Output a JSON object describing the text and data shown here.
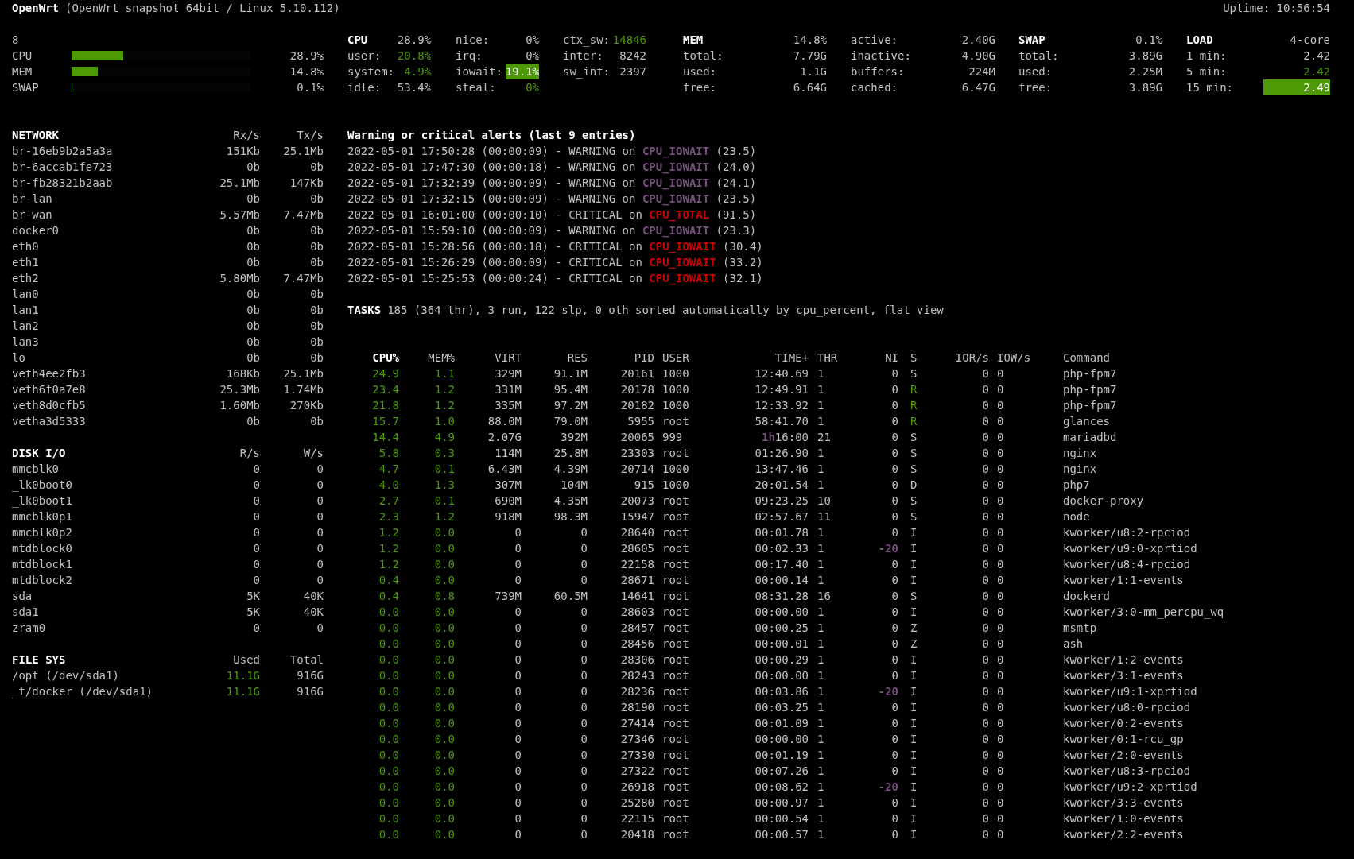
{
  "header": {
    "hostname": "OpenWrt",
    "system": "(OpenWrt snapshot 64bit / Linux 5.10.112)",
    "uptime": "Uptime: 10:56:54"
  },
  "quicklook": {
    "label": "8",
    "bars": [
      {
        "label": "CPU",
        "level": 0.289,
        "value": "28.9%"
      },
      {
        "label": "MEM",
        "level": 0.148,
        "value": "14.8%"
      },
      {
        "label": "SWAP",
        "level": 0.001,
        "value": "0.1%"
      }
    ]
  },
  "cpu": {
    "title": "CPU",
    "value": "28.9%",
    "stats": [
      {
        "label": "user:",
        "value": "20.8%",
        "good": true,
        "highlighted": false
      },
      {
        "label": "system:",
        "value": "4.9%",
        "good": true,
        "highlighted": false
      },
      {
        "label": "idle:",
        "value": "53.4%",
        "good": false,
        "highlighted": false
      }
    ],
    "extra_columns": [
      [
        {
          "label": "nice:",
          "value": "0%",
          "good": false,
          "highlighted": false
        },
        {
          "label": "irq:",
          "value": "0%",
          "good": false,
          "highlighted": false
        },
        {
          "label": "iowait:",
          "value": "19.1%",
          "good": true,
          "highlighted": true
        },
        {
          "label": "steal:",
          "value": "0%",
          "good": true,
          "highlighted": false
        }
      ],
      [
        {
          "label": "ctx_sw:",
          "value": "14846",
          "good": true,
          "highlighted": false
        },
        {
          "label": "inter:",
          "value": "8242",
          "good": false,
          "highlighted": false
        },
        {
          "label": "sw_int:",
          "value": "2397",
          "good": false,
          "highlighted": false
        }
      ]
    ]
  },
  "mem": {
    "title": "MEM",
    "value": "14.8%",
    "stats": [
      {
        "label": "total:",
        "value": "7.79G",
        "good": false,
        "highlighted": false
      },
      {
        "label": "used:",
        "value": "1.1G",
        "good": false,
        "highlighted": false
      },
      {
        "label": "free:",
        "value": "6.64G",
        "good": false,
        "highlighted": false
      }
    ],
    "extra_columns": [
      [
        {
          "label": "active:",
          "value": "2.40G",
          "good": false,
          "highlighted": false
        },
        {
          "label": "inactive:",
          "value": "4.90G",
          "good": false,
          "highlighted": false
        },
        {
          "label": "buffers:",
          "value": "224M",
          "good": false,
          "highlighted": false
        },
        {
          "label": "cached:",
          "value": "6.47G",
          "good": false,
          "highlighted": false
        }
      ]
    ]
  },
  "swap": {
    "title": "SWAP",
    "value": "0.1%",
    "stats": [
      {
        "label": "total:",
        "value": "3.89G",
        "good": false,
        "highlighted": false
      },
      {
        "label": "used:",
        "value": "2.25M",
        "good": false,
        "highlighted": false
      },
      {
        "label": "free:",
        "value": "3.89G",
        "good": false,
        "highlighted": false
      }
    ]
  },
  "load": {
    "title": "LOAD",
    "value": "4-core",
    "stats": [
      {
        "label": "1 min:",
        "value": "2.42",
        "good": false,
        "highlighted": false
      },
      {
        "label": "5 min:",
        "value": "2.42",
        "good": true,
        "highlighted": false
      },
      {
        "label": "15 min:",
        "value": "2.49",
        "good": true,
        "highlighted": true
      }
    ]
  },
  "network": {
    "title": "NETWORK",
    "columns": [
      "Rx/s",
      "Tx/s"
    ],
    "rows": [
      {
        "name": "br-16eb9b2a5a3a",
        "rx": "151Kb",
        "tx": "25.1Mb"
      },
      {
        "name": "br-6accab1fe723",
        "rx": "0b",
        "tx": "0b"
      },
      {
        "name": "br-fb28321b2aab",
        "rx": "25.1Mb",
        "tx": "147Kb"
      },
      {
        "name": "br-lan",
        "rx": "0b",
        "tx": "0b"
      },
      {
        "name": "br-wan",
        "rx": "5.57Mb",
        "tx": "7.47Mb"
      },
      {
        "name": "docker0",
        "rx": "0b",
        "tx": "0b"
      },
      {
        "name": "eth0",
        "rx": "0b",
        "tx": "0b"
      },
      {
        "name": "eth1",
        "rx": "0b",
        "tx": "0b"
      },
      {
        "name": "eth2",
        "rx": "5.80Mb",
        "tx": "7.47Mb"
      },
      {
        "name": "lan0",
        "rx": "0b",
        "tx": "0b"
      },
      {
        "name": "lan1",
        "rx": "0b",
        "tx": "0b"
      },
      {
        "name": "lan2",
        "rx": "0b",
        "tx": "0b"
      },
      {
        "name": "lan3",
        "rx": "0b",
        "tx": "0b"
      },
      {
        "name": "lo",
        "rx": "0b",
        "tx": "0b"
      },
      {
        "name": "veth4ee2fb3",
        "rx": "168Kb",
        "tx": "25.1Mb"
      },
      {
        "name": "veth6f0a7e8",
        "rx": "25.3Mb",
        "tx": "1.74Mb"
      },
      {
        "name": "veth8d0cfb5",
        "rx": "1.60Mb",
        "tx": "270Kb"
      },
      {
        "name": "vetha3d5333",
        "rx": "0b",
        "tx": "0b"
      }
    ]
  },
  "disk_io": {
    "title": "DISK I/O",
    "columns": [
      "R/s",
      "W/s"
    ],
    "rows": [
      {
        "name": "mmcblk0",
        "rx": "0",
        "tx": "0"
      },
      {
        "name": "_lk0boot0",
        "rx": "0",
        "tx": "0"
      },
      {
        "name": "_lk0boot1",
        "rx": "0",
        "tx": "0"
      },
      {
        "name": "mmcblk0p1",
        "rx": "0",
        "tx": "0"
      },
      {
        "name": "mmcblk0p2",
        "rx": "0",
        "tx": "0"
      },
      {
        "name": "mtdblock0",
        "rx": "0",
        "tx": "0"
      },
      {
        "name": "mtdblock1",
        "rx": "0",
        "tx": "0"
      },
      {
        "name": "mtdblock2",
        "rx": "0",
        "tx": "0"
      },
      {
        "name": "sda",
        "rx": "5K",
        "tx": "40K"
      },
      {
        "name": "sda1",
        "rx": "5K",
        "tx": "40K"
      },
      {
        "name": "zram0",
        "rx": "0",
        "tx": "0"
      }
    ]
  },
  "file_sys": {
    "title": "FILE SYS",
    "columns": [
      "Used",
      "Total"
    ],
    "rows": [
      {
        "name": "/opt (/dev/sda1)",
        "rx": "11.1G",
        "tx": "916G"
      },
      {
        "name": "_t/docker (/dev/sda1)",
        "rx": "11.1G",
        "tx": "916G"
      }
    ]
  },
  "alerts": {
    "title": "Warning or critical alerts (last 9 entries)",
    "entries": [
      {
        "text": "2022-05-01 17:50:28 (00:00:09) - WARNING on",
        "metric": "CPU_IOWAIT",
        "value": "(23.5)",
        "critical": false
      },
      {
        "text": "2022-05-01 17:47:30 (00:00:18) - WARNING on",
        "metric": "CPU_IOWAIT",
        "value": "(24.0)",
        "critical": false
      },
      {
        "text": "2022-05-01 17:32:39 (00:00:09) - WARNING on",
        "metric": "CPU_IOWAIT",
        "value": "(24.1)",
        "critical": false
      },
      {
        "text": "2022-05-01 17:32:15 (00:00:09) - WARNING on",
        "metric": "CPU_IOWAIT",
        "value": "(23.5)",
        "critical": false
      },
      {
        "text": "2022-05-01 16:01:00 (00:00:10) - CRITICAL on",
        "metric": "CPU_TOTAL",
        "value": "(91.5)",
        "critical": true
      },
      {
        "text": "2022-05-01 15:59:10 (00:00:09) - WARNING on",
        "metric": "CPU_IOWAIT",
        "value": "(23.3)",
        "critical": false
      },
      {
        "text": "2022-05-01 15:28:56 (00:00:18) - CRITICAL on",
        "metric": "CPU_IOWAIT",
        "value": "(30.4)",
        "critical": true
      },
      {
        "text": "2022-05-01 15:26:29 (00:00:09) - CRITICAL on",
        "metric": "CPU_IOWAIT",
        "value": "(33.2)",
        "critical": true
      },
      {
        "text": "2022-05-01 15:25:53 (00:00:24) - CRITICAL on",
        "metric": "CPU_IOWAIT",
        "value": "(32.1)",
        "critical": true
      }
    ]
  },
  "tasks": {
    "title": "TASKS",
    "summary": "185 (364 thr), 3 run, 122 slp, 0 oth sorted automatically by cpu_percent, flat view"
  },
  "processes": {
    "columns": [
      {
        "label": "CPU%",
        "selected": true
      },
      {
        "label": "MEM%",
        "selected": false
      },
      {
        "label": "VIRT",
        "selected": false
      },
      {
        "label": "RES",
        "selected": false
      },
      {
        "label": "PID",
        "selected": false
      },
      {
        "label": "USER",
        "selected": false
      },
      {
        "label": "TIME+",
        "selected": false
      },
      {
        "label": "THR",
        "selected": false
      },
      {
        "label": "NI",
        "selected": false
      },
      {
        "label": "S",
        "selected": false
      },
      {
        "label": "IOR/s",
        "selected": false
      },
      {
        "label": "IOW/s",
        "selected": false
      },
      {
        "label": "Command",
        "selected": false
      }
    ],
    "rows": [
      {
        "cpu": "24.9",
        "mem": "1.1",
        "virt": "329M",
        "res": "91.1M",
        "pid": "20161",
        "user": "1000",
        "time": "12:40.69",
        "thr": "1",
        "ni": "0",
        "ni_alert": false,
        "s": "S",
        "s_running": false,
        "ior": "0",
        "iow": "0",
        "command": "php-fpm7"
      },
      {
        "cpu": "23.4",
        "mem": "1.2",
        "virt": "331M",
        "res": "95.4M",
        "pid": "20178",
        "user": "1000",
        "time": "12:49.91",
        "thr": "1",
        "ni": "0",
        "ni_alert": false,
        "s": "R",
        "s_running": true,
        "ior": "0",
        "iow": "0",
        "command": "php-fpm7"
      },
      {
        "cpu": "21.8",
        "mem": "1.2",
        "virt": "335M",
        "res": "97.2M",
        "pid": "20182",
        "user": "1000",
        "time": "12:33.92",
        "thr": "1",
        "ni": "0",
        "ni_alert": false,
        "s": "R",
        "s_running": true,
        "ior": "0",
        "iow": "0",
        "command": "php-fpm7"
      },
      {
        "cpu": "15.7",
        "mem": "1.0",
        "virt": "88.0M",
        "res": "79.0M",
        "pid": "5955",
        "user": "root",
        "time": "58:41.70",
        "thr": "1",
        "ni": "0",
        "ni_alert": false,
        "s": "R",
        "s_running": true,
        "ior": "0",
        "iow": "0",
        "command": "glances"
      },
      {
        "cpu": "14.4",
        "mem": "4.9",
        "virt": "2.07G",
        "res": "392M",
        "pid": "20065",
        "user": "999",
        "time_prefix": "1h",
        "time": "16:00",
        "thr": "21",
        "ni": "0",
        "ni_alert": false,
        "s": "S",
        "s_running": false,
        "ior": "0",
        "iow": "0",
        "command": "mariadbd"
      },
      {
        "cpu": "5.8",
        "mem": "0.3",
        "virt": "114M",
        "res": "25.8M",
        "pid": "23303",
        "user": "root",
        "time": "01:26.90",
        "thr": "1",
        "ni": "0",
        "ni_alert": false,
        "s": "S",
        "s_running": false,
        "ior": "0",
        "iow": "0",
        "command": "nginx"
      },
      {
        "cpu": "4.7",
        "mem": "0.1",
        "virt": "6.43M",
        "res": "4.39M",
        "pid": "20714",
        "user": "1000",
        "time": "13:47.46",
        "thr": "1",
        "ni": "0",
        "ni_alert": false,
        "s": "S",
        "s_running": false,
        "ior": "0",
        "iow": "0",
        "command": "nginx"
      },
      {
        "cpu": "4.0",
        "mem": "1.3",
        "virt": "307M",
        "res": "104M",
        "pid": "915",
        "user": "1000",
        "time": "20:01.54",
        "thr": "1",
        "ni": "0",
        "ni_alert": false,
        "s": "D",
        "s_running": false,
        "ior": "0",
        "iow": "0",
        "command": "php7"
      },
      {
        "cpu": "2.7",
        "mem": "0.1",
        "virt": "690M",
        "res": "4.35M",
        "pid": "20073",
        "user": "root",
        "time": "09:23.25",
        "thr": "10",
        "ni": "0",
        "ni_alert": false,
        "s": "S",
        "s_running": false,
        "ior": "0",
        "iow": "0",
        "command": "docker-proxy"
      },
      {
        "cpu": "2.3",
        "mem": "1.2",
        "virt": "918M",
        "res": "98.3M",
        "pid": "15947",
        "user": "root",
        "time": "02:57.67",
        "thr": "11",
        "ni": "0",
        "ni_alert": false,
        "s": "S",
        "s_running": false,
        "ior": "0",
        "iow": "0",
        "command": "node"
      },
      {
        "cpu": "1.2",
        "mem": "0.0",
        "virt": "0",
        "res": "0",
        "pid": "28640",
        "user": "root",
        "time": "00:01.78",
        "thr": "1",
        "ni": "0",
        "ni_alert": false,
        "s": "I",
        "s_running": false,
        "ior": "0",
        "iow": "0",
        "command": "kworker/u8:2-rpciod"
      },
      {
        "cpu": "1.2",
        "mem": "0.0",
        "virt": "0",
        "res": "0",
        "pid": "28605",
        "user": "root",
        "time": "00:02.33",
        "thr": "1",
        "ni": "-20",
        "ni_alert": true,
        "s": "I",
        "s_running": false,
        "ior": "0",
        "iow": "0",
        "command": "kworker/u9:0-xprtiod"
      },
      {
        "cpu": "1.2",
        "mem": "0.0",
        "virt": "0",
        "res": "0",
        "pid": "22158",
        "user": "root",
        "time": "00:17.40",
        "thr": "1",
        "ni": "0",
        "ni_alert": false,
        "s": "I",
        "s_running": false,
        "ior": "0",
        "iow": "0",
        "command": "kworker/u8:4-rpciod"
      },
      {
        "cpu": "0.4",
        "mem": "0.0",
        "virt": "0",
        "res": "0",
        "pid": "28671",
        "user": "root",
        "time": "00:00.14",
        "thr": "1",
        "ni": "0",
        "ni_alert": false,
        "s": "I",
        "s_running": false,
        "ior": "0",
        "iow": "0",
        "command": "kworker/1:1-events"
      },
      {
        "cpu": "0.4",
        "mem": "0.8",
        "virt": "739M",
        "res": "60.5M",
        "pid": "14641",
        "user": "root",
        "time": "08:31.28",
        "thr": "16",
        "ni": "0",
        "ni_alert": false,
        "s": "S",
        "s_running": false,
        "ior": "0",
        "iow": "0",
        "command": "dockerd"
      },
      {
        "cpu": "0.0",
        "mem": "0.0",
        "virt": "0",
        "res": "0",
        "pid": "28603",
        "user": "root",
        "time": "00:00.00",
        "thr": "1",
        "ni": "0",
        "ni_alert": false,
        "s": "I",
        "s_running": false,
        "ior": "0",
        "iow": "0",
        "command": "kworker/3:0-mm_percpu_wq"
      },
      {
        "cpu": "0.0",
        "mem": "0.0",
        "virt": "0",
        "res": "0",
        "pid": "28457",
        "user": "root",
        "time": "00:00.25",
        "thr": "1",
        "ni": "0",
        "ni_alert": false,
        "s": "Z",
        "s_running": false,
        "ior": "0",
        "iow": "0",
        "command": "msmtp"
      },
      {
        "cpu": "0.0",
        "mem": "0.0",
        "virt": "0",
        "res": "0",
        "pid": "28456",
        "user": "root",
        "time": "00:00.01",
        "thr": "1",
        "ni": "0",
        "ni_alert": false,
        "s": "Z",
        "s_running": false,
        "ior": "0",
        "iow": "0",
        "command": "ash"
      },
      {
        "cpu": "0.0",
        "mem": "0.0",
        "virt": "0",
        "res": "0",
        "pid": "28306",
        "user": "root",
        "time": "00:00.29",
        "thr": "1",
        "ni": "0",
        "ni_alert": false,
        "s": "I",
        "s_running": false,
        "ior": "0",
        "iow": "0",
        "command": "kworker/1:2-events"
      },
      {
        "cpu": "0.0",
        "mem": "0.0",
        "virt": "0",
        "res": "0",
        "pid": "28243",
        "user": "root",
        "time": "00:00.00",
        "thr": "1",
        "ni": "0",
        "ni_alert": false,
        "s": "I",
        "s_running": false,
        "ior": "0",
        "iow": "0",
        "command": "kworker/3:1-events"
      },
      {
        "cpu": "0.0",
        "mem": "0.0",
        "virt": "0",
        "res": "0",
        "pid": "28236",
        "user": "root",
        "time": "00:03.86",
        "thr": "1",
        "ni": "-20",
        "ni_alert": true,
        "s": "I",
        "s_running": false,
        "ior": "0",
        "iow": "0",
        "command": "kworker/u9:1-xprtiod"
      },
      {
        "cpu": "0.0",
        "mem": "0.0",
        "virt": "0",
        "res": "0",
        "pid": "28190",
        "user": "root",
        "time": "00:03.25",
        "thr": "1",
        "ni": "0",
        "ni_alert": false,
        "s": "I",
        "s_running": false,
        "ior": "0",
        "iow": "0",
        "command": "kworker/u8:0-rpciod"
      },
      {
        "cpu": "0.0",
        "mem": "0.0",
        "virt": "0",
        "res": "0",
        "pid": "27414",
        "user": "root",
        "time": "00:01.09",
        "thr": "1",
        "ni": "0",
        "ni_alert": false,
        "s": "I",
        "s_running": false,
        "ior": "0",
        "iow": "0",
        "command": "kworker/0:2-events"
      },
      {
        "cpu": "0.0",
        "mem": "0.0",
        "virt": "0",
        "res": "0",
        "pid": "27346",
        "user": "root",
        "time": "00:00.00",
        "thr": "1",
        "ni": "0",
        "ni_alert": false,
        "s": "I",
        "s_running": false,
        "ior": "0",
        "iow": "0",
        "command": "kworker/0:1-rcu_gp"
      },
      {
        "cpu": "0.0",
        "mem": "0.0",
        "virt": "0",
        "res": "0",
        "pid": "27330",
        "user": "root",
        "time": "00:01.19",
        "thr": "1",
        "ni": "0",
        "ni_alert": false,
        "s": "I",
        "s_running": false,
        "ior": "0",
        "iow": "0",
        "command": "kworker/2:0-events"
      },
      {
        "cpu": "0.0",
        "mem": "0.0",
        "virt": "0",
        "res": "0",
        "pid": "27322",
        "user": "root",
        "time": "00:07.26",
        "thr": "1",
        "ni": "0",
        "ni_alert": false,
        "s": "I",
        "s_running": false,
        "ior": "0",
        "iow": "0",
        "command": "kworker/u8:3-rpciod"
      },
      {
        "cpu": "0.0",
        "mem": "0.0",
        "virt": "0",
        "res": "0",
        "pid": "26918",
        "user": "root",
        "time": "00:08.62",
        "thr": "1",
        "ni": "-20",
        "ni_alert": true,
        "s": "I",
        "s_running": false,
        "ior": "0",
        "iow": "0",
        "command": "kworker/u9:2-xprtiod"
      },
      {
        "cpu": "0.0",
        "mem": "0.0",
        "virt": "0",
        "res": "0",
        "pid": "25280",
        "user": "root",
        "time": "00:00.97",
        "thr": "1",
        "ni": "0",
        "ni_alert": false,
        "s": "I",
        "s_running": false,
        "ior": "0",
        "iow": "0",
        "command": "kworker/3:3-events"
      },
      {
        "cpu": "0.0",
        "mem": "0.0",
        "virt": "0",
        "res": "0",
        "pid": "22115",
        "user": "root",
        "time": "00:00.54",
        "thr": "1",
        "ni": "0",
        "ni_alert": false,
        "s": "I",
        "s_running": false,
        "ior": "0",
        "iow": "0",
        "command": "kworker/1:0-events"
      },
      {
        "cpu": "0.0",
        "mem": "0.0",
        "virt": "0",
        "res": "0",
        "pid": "20418",
        "user": "root",
        "time": "00:00.57",
        "thr": "1",
        "ni": "0",
        "ni_alert": false,
        "s": "I",
        "s_running": false,
        "ior": "0",
        "iow": "0",
        "command": "kworker/2:2-events"
      }
    ]
  }
}
